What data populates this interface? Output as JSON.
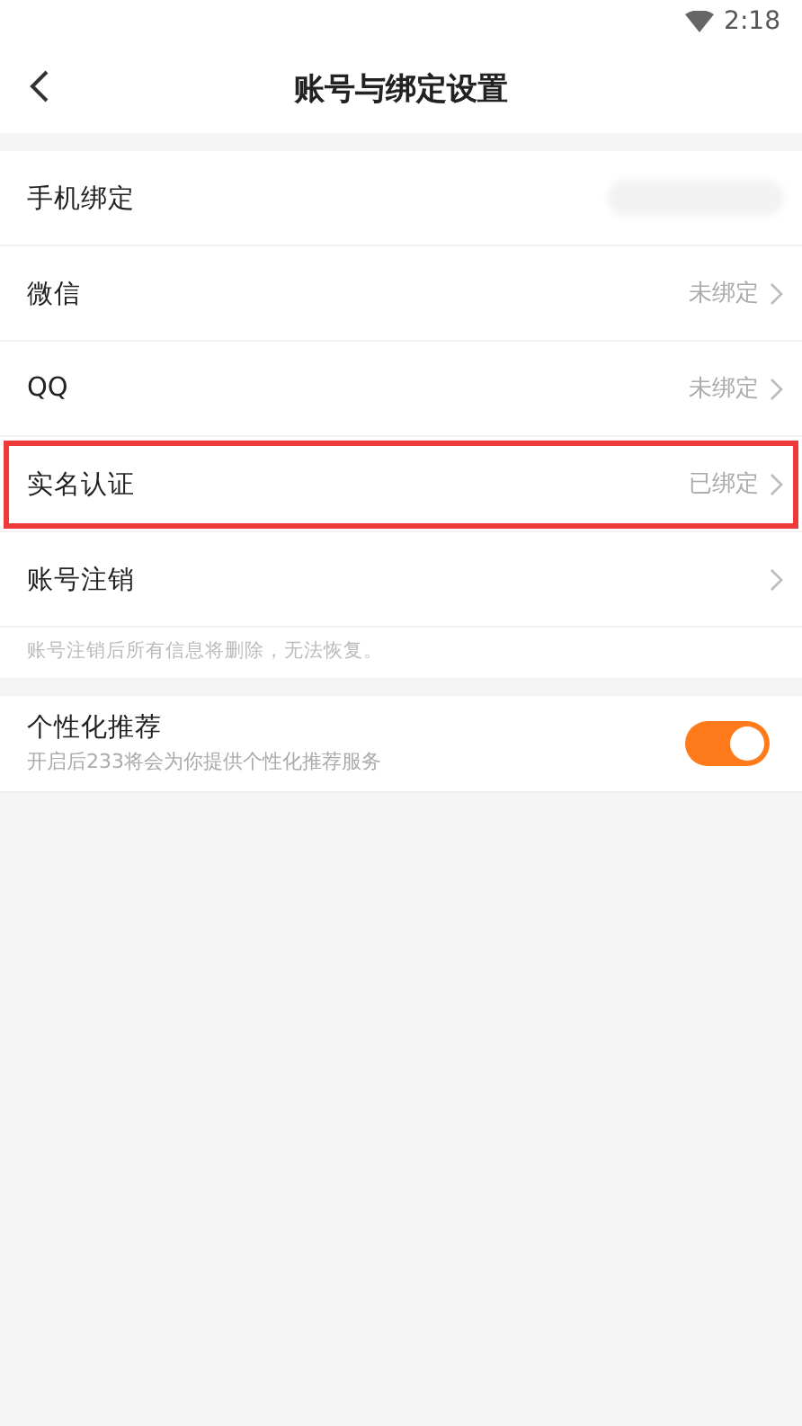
{
  "status_bar": {
    "time": "2:18"
  },
  "nav": {
    "title": "账号与绑定设置"
  },
  "rows": [
    {
      "kind": "blurred",
      "label": "手机绑定",
      "highlighted": false
    },
    {
      "kind": "value",
      "label": "微信",
      "value": "未绑定",
      "highlighted": false
    },
    {
      "kind": "value",
      "label": "QQ",
      "value": "未绑定",
      "highlighted": false
    },
    {
      "kind": "value",
      "label": "实名认证",
      "value": "已绑定",
      "highlighted": true
    },
    {
      "kind": "arrow",
      "label": "账号注销",
      "highlighted": false
    }
  ],
  "note": "账号注销后所有信息将删除，无法恢复。",
  "recommend": {
    "title": "个性化推荐",
    "subtitle": "开启后233将会为你提供个性化推荐服务",
    "on": true
  }
}
